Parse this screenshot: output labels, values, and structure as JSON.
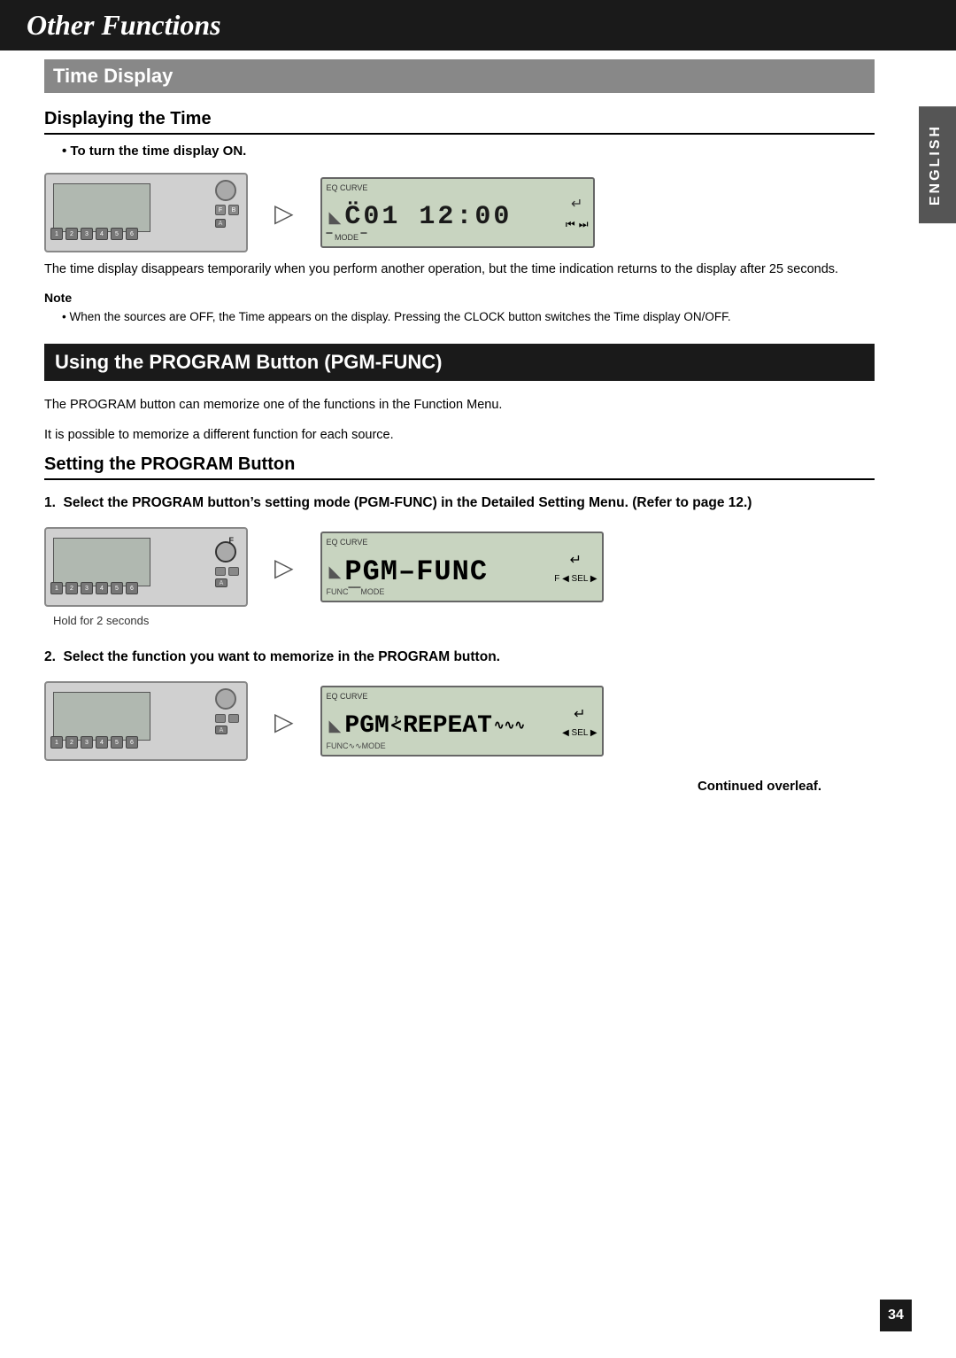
{
  "header": {
    "title": "Other Functions"
  },
  "sideTab": {
    "label": "ENGLISH"
  },
  "section1": {
    "title": "Time Display",
    "subsection1": {
      "title": "Displaying the Time",
      "bullet1": "To turn the time display ON.",
      "body1": "The time display disappears temporarily when you perform another operation, but the time indication returns to the display after 25 seconds.",
      "note": {
        "title": "Note",
        "text": "When the sources are OFF, the Time appears on the display. Pressing the CLOCK button switches the Time display ON/OFF."
      }
    }
  },
  "section2": {
    "title": "Using the PROGRAM Button (PGM-FUNC)",
    "intro1": "The PROGRAM button can memorize one of the functions in the Function Menu.",
    "intro2": "It is possible to memorize a different function for each source.",
    "subsection1": {
      "title": "Setting the PROGRAM Button",
      "step1": {
        "label": "1.  Select the PROGRAM button’s setting mode (PGM-FUNC) in the Detailed Setting Menu. (Refer to page 12.)",
        "caption": "Hold for 2 seconds",
        "display_text": "PGM–FUNC"
      },
      "step2": {
        "label": "2.  Select the function you want to memorize in the PROGRAM button.",
        "display_text": "PGM REPEAT"
      }
    }
  },
  "time_display": {
    "text": "C·01  12·00"
  },
  "footer": {
    "continued": "Continued overleaf.",
    "page_number": "34"
  }
}
